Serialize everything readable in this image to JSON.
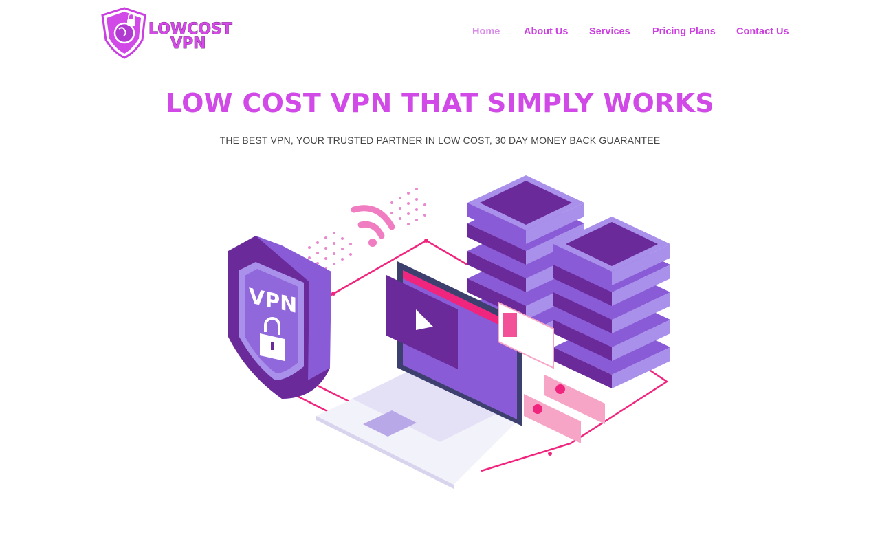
{
  "logo": {
    "line1": "LOWCOST",
    "line2": "VPN"
  },
  "nav": {
    "home": "Home",
    "about": "About Us",
    "services": "Services",
    "pricing": "Pricing Plans",
    "contact": "Contact Us"
  },
  "hero": {
    "title": "LOW COST VPN THAT SIMPLY WORKS",
    "subtitle": "THE BEST VPN, YOUR TRUSTED PARTNER IN LOW COST, 30 DAY MONEY BACK GUARANTEE"
  },
  "illustration": {
    "shield_label": "VPN",
    "colors": {
      "purple_dark": "#6a2a9a",
      "purple_mid": "#8a5bd6",
      "purple_light": "#a990ea",
      "pink": "#f0257d",
      "pink_light": "#f7a5c6"
    }
  }
}
